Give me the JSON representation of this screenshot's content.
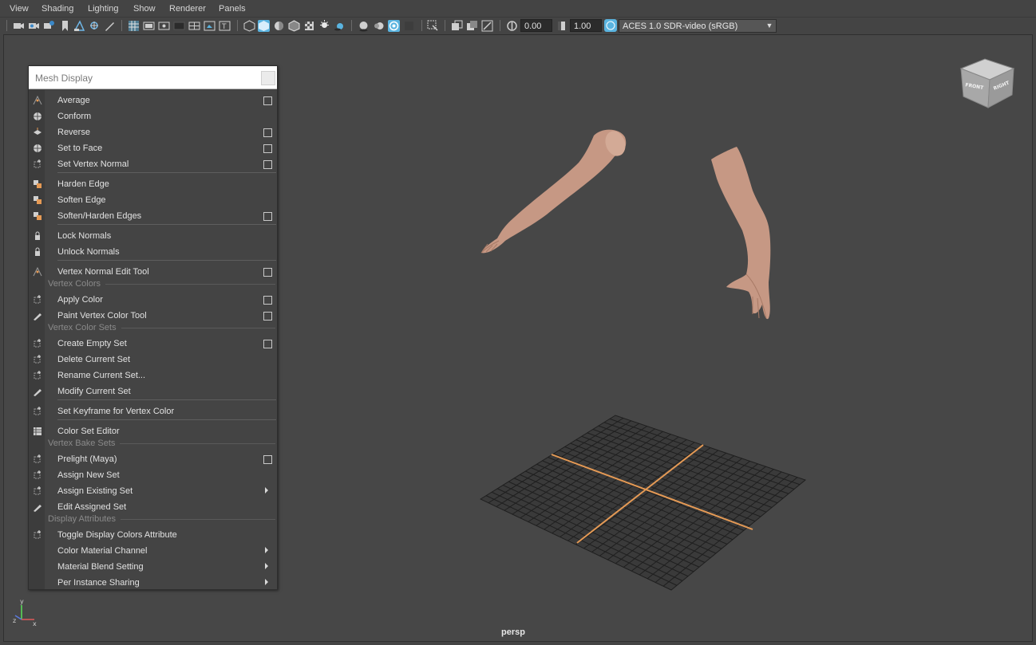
{
  "menubar": {
    "items": [
      "View",
      "Shading",
      "Lighting",
      "Show",
      "Renderer",
      "Panels"
    ]
  },
  "toolbar": {
    "exposure_value": "0.00",
    "gamma_value": "1.00",
    "color_space": "ACES 1.0 SDR-video (sRGB)"
  },
  "panel": {
    "title": "Mesh Display",
    "sections": {
      "vertex_colors": "Vertex Colors",
      "vertex_color_sets": "Vertex Color Sets",
      "vertex_bake_sets": "Vertex Bake Sets",
      "display_attributes": "Display Attributes"
    },
    "items": [
      {
        "label": "Average",
        "icon": "average-normals-icon",
        "option_box": true
      },
      {
        "label": "Conform",
        "icon": "conform-icon",
        "option_box": false
      },
      {
        "label": "Reverse",
        "icon": "reverse-normals-icon",
        "option_box": true
      },
      {
        "label": "Set to Face",
        "icon": "set-to-face-icon",
        "option_box": true
      },
      {
        "label": "Set Vertex Normal",
        "icon": "set-vertex-normal-icon",
        "option_box": true
      },
      {
        "label": "Harden Edge",
        "icon": "harden-edge-icon",
        "option_box": false
      },
      {
        "label": "Soften Edge",
        "icon": "soften-edge-icon",
        "option_box": false
      },
      {
        "label": "Soften/Harden Edges",
        "icon": "soften-harden-edges-icon",
        "option_box": true
      },
      {
        "label": "Lock Normals",
        "icon": "lock-normals-icon",
        "option_box": false
      },
      {
        "label": "Unlock Normals",
        "icon": "unlock-normals-icon",
        "option_box": false
      },
      {
        "label": "Vertex Normal Edit Tool",
        "icon": "vertex-normal-edit-icon",
        "option_box": true
      },
      {
        "label": "Apply Color",
        "icon": "apply-color-icon",
        "option_box": true
      },
      {
        "label": "Paint Vertex Color Tool",
        "icon": "paint-brush-icon",
        "option_box": true
      },
      {
        "label": "Create Empty Set",
        "icon": "create-set-icon",
        "option_box": true
      },
      {
        "label": "Delete Current Set",
        "icon": "delete-set-icon",
        "option_box": false
      },
      {
        "label": "Rename Current Set...",
        "icon": "rename-set-icon",
        "option_box": false
      },
      {
        "label": "Modify Current Set",
        "icon": "modify-set-icon",
        "option_box": false
      },
      {
        "label": "Set Keyframe for Vertex Color",
        "icon": "keyframe-color-icon",
        "option_box": false
      },
      {
        "label": "Color Set Editor",
        "icon": "color-set-editor-icon",
        "option_box": false
      },
      {
        "label": "Prelight (Maya)",
        "icon": "prelight-icon",
        "option_box": true
      },
      {
        "label": "Assign New Set",
        "icon": "assign-new-set-icon",
        "option_box": false
      },
      {
        "label": "Assign Existing Set",
        "icon": "assign-existing-set-icon",
        "submenu": true
      },
      {
        "label": "Edit Assigned Set",
        "icon": "edit-assigned-set-icon",
        "option_box": false
      },
      {
        "label": "Toggle Display Colors Attribute",
        "icon": "toggle-display-colors-icon",
        "option_box": false
      },
      {
        "label": "Color Material Channel",
        "icon": "",
        "submenu": true
      },
      {
        "label": "Material Blend Setting",
        "icon": "",
        "submenu": true
      },
      {
        "label": "Per Instance Sharing",
        "icon": "",
        "submenu": true
      }
    ]
  },
  "viewport": {
    "camera_label": "persp",
    "view_cube": {
      "front": "FRONT",
      "right": "RIGHT"
    },
    "axis": {
      "y": "y",
      "x": "x",
      "z": "z"
    }
  },
  "colors": {
    "bg": "#444444",
    "viewport_bg": "#474747",
    "skin": "#c89b86",
    "grid_axis": "#e59a55",
    "highlight": "#5ab4e0"
  }
}
